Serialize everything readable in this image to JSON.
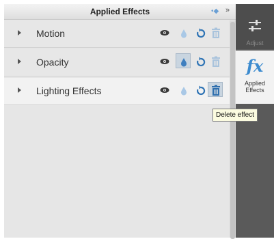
{
  "panel": {
    "title": "Applied Effects"
  },
  "effects": [
    {
      "label": "Motion",
      "selected": false,
      "visibility_button": "eye-icon",
      "keyframe_button": "drop-icon",
      "reset_button": "reset-icon",
      "delete_button": "trash-icon"
    },
    {
      "label": "Opacity",
      "selected": false,
      "visibility_button": "eye-icon",
      "keyframe_button": "drop-icon",
      "reset_button": "reset-icon",
      "delete_button": "trash-icon"
    },
    {
      "label": "Lighting Effects",
      "selected": true,
      "visibility_button": "eye-icon",
      "keyframe_button": "drop-icon",
      "reset_button": "reset-icon",
      "delete_button": "trash-icon"
    }
  ],
  "side_tabs": {
    "adjust": {
      "label": "Adjust",
      "icon": "sliders-icon"
    },
    "applied_effects": {
      "label_line1": "Applied",
      "label_line2": "Effects",
      "icon": "fx-icon",
      "fx_glyph": "fx"
    }
  },
  "tooltip": {
    "text": "Delete effect"
  },
  "colors": {
    "accent": "#3c8bcf",
    "panel_bg": "#e6e6e6",
    "side_panel_bg": "#5a5a5a",
    "tooltip_bg": "#fbfbe0"
  }
}
